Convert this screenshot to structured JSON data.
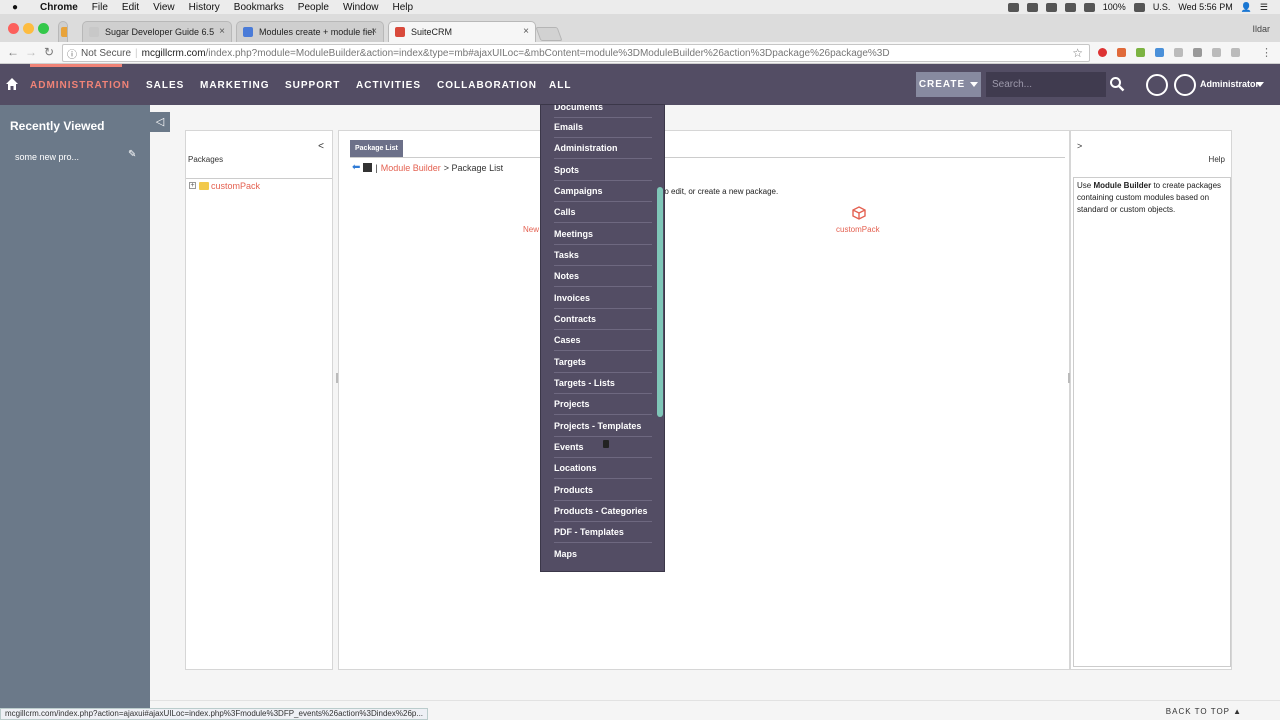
{
  "mac": {
    "apple_icon": "apple-icon",
    "app_name": "Chrome",
    "menu": [
      "File",
      "Edit",
      "View",
      "History",
      "Bookmarks",
      "People",
      "Window",
      "Help"
    ],
    "battery": "100%",
    "locale": "U.S.",
    "clock": "Wed 5:56 PM"
  },
  "browser": {
    "tabs": [
      {
        "title": "Sugar Developer Guide 6.5",
        "close": "×",
        "favicon_color": "#e8a33a"
      },
      {
        "title": "Modules create + module fiel",
        "close": "×",
        "favicon_color": "#4a7bd8"
      },
      {
        "title": "SuiteCRM",
        "close": "×",
        "favicon_color": "#d94a3c"
      }
    ],
    "profile_name": "Ildar",
    "security_label": "Not Secure",
    "url_host": "mcgillcrm.com",
    "url_path": "/index.php?module=ModuleBuilder&action=index&type=mb#ajaxUILoc=&mbContent=module%3DModuleBuilder%26action%3Dpackage%26package%3D",
    "status_url": "mcgillcrm.com/index.php?action=ajaxui#ajaxUILoc=index.php%3Fmodule%3DFP_events%26action%3Dindex%26p..."
  },
  "nav": {
    "items": [
      "ADMINISTRATION",
      "SALES",
      "MARKETING",
      "SUPPORT",
      "ACTIVITIES",
      "COLLABORATION",
      "ALL"
    ],
    "create_label": "CREATE",
    "search_placeholder": "Search...",
    "user_label": "Administrator",
    "accent": "#f08377",
    "bar_color": "#534d64"
  },
  "sidebar": {
    "title": "Recently Viewed",
    "items": [
      "some new pro..."
    ],
    "collapse_glyph": "◁"
  },
  "packages_panel": {
    "collapse_glyph": "<",
    "title": "Packages",
    "tree": [
      {
        "label": "customPack"
      }
    ]
  },
  "main": {
    "tab_label": "Package List",
    "breadcrumb_link": "Module Builder",
    "breadcrumb_sep": "|",
    "breadcrumb_current": "> Package List",
    "instruction_visible": "ge to edit, or create a new package.",
    "new_package_visible": "New",
    "package_name": "customPack"
  },
  "help_panel": {
    "expand_glyph": ">",
    "title": "Help",
    "text_prefix": "Use ",
    "text_bold": "Module Builder",
    "text_suffix": " to create packages containing custom modules based on standard or custom objects."
  },
  "all_menu": {
    "items": [
      "Documents",
      "Emails",
      "Administration",
      "Spots",
      "Campaigns",
      "Calls",
      "Meetings",
      "Tasks",
      "Notes",
      "Invoices",
      "Contracts",
      "Cases",
      "Targets",
      "Targets - Lists",
      "Projects",
      "Projects - Templates",
      "Events",
      "Locations",
      "Products",
      "Products - Categories",
      "PDF - Templates",
      "Maps"
    ],
    "scroll_color": "#7fc6b8"
  },
  "footer": {
    "back_to_top": "BACK TO TOP"
  }
}
